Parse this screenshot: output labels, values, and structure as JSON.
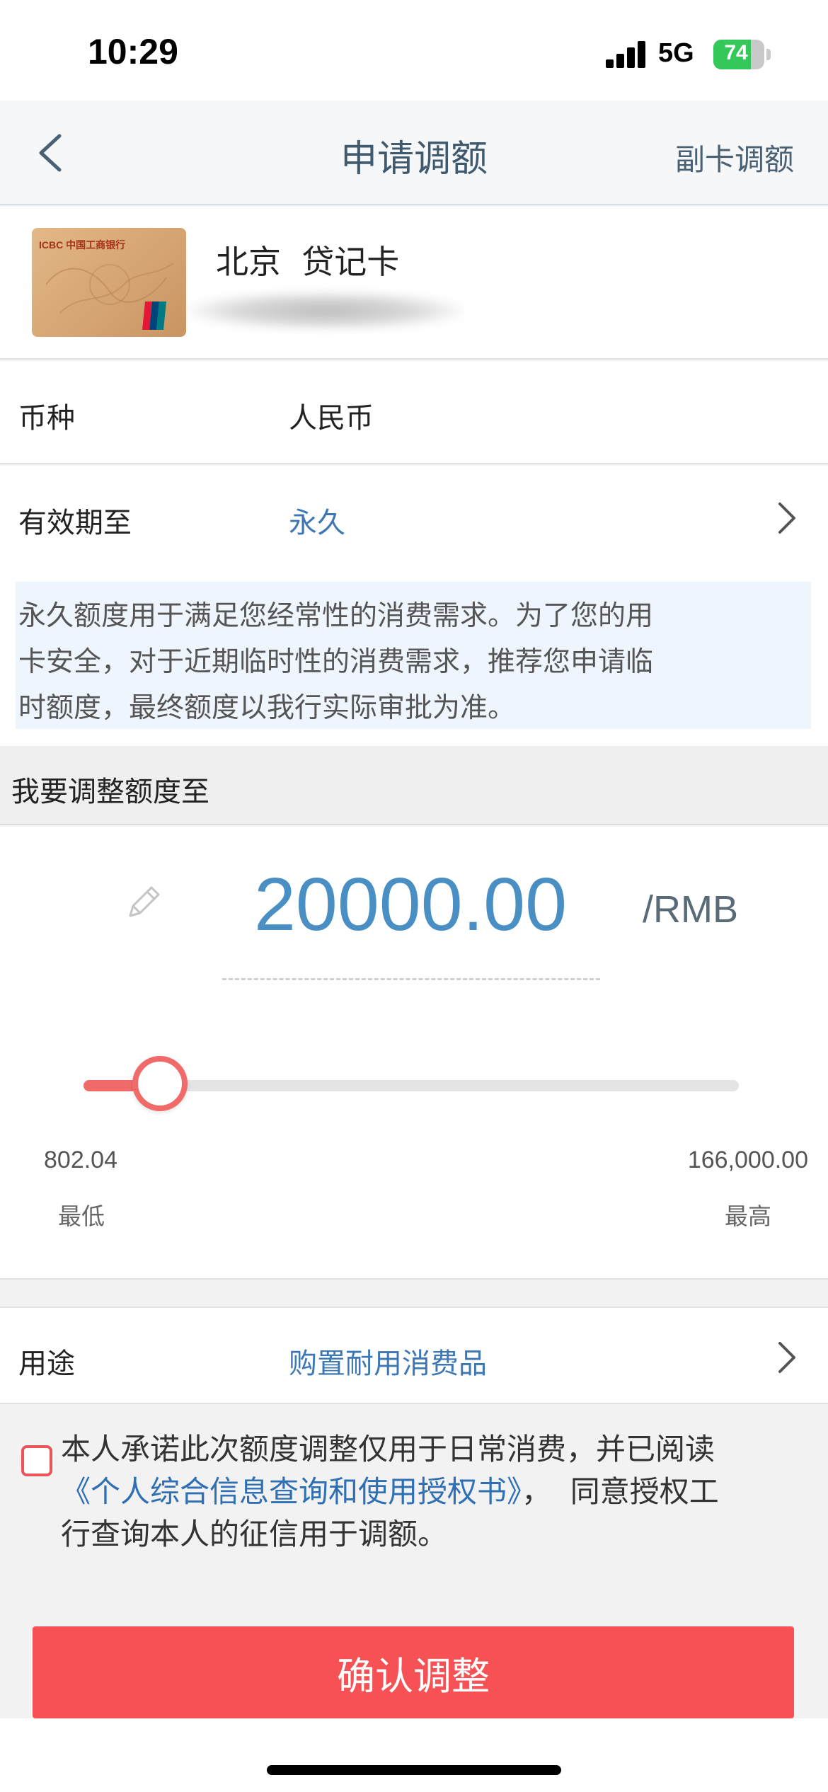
{
  "status_bar": {
    "time": "10:29",
    "network": "5G",
    "battery_percent": "74",
    "battery_level": 0.74,
    "battery_color": "#34c759"
  },
  "nav": {
    "back_icon": "chevron-left-icon",
    "title": "申请调额",
    "right_action": "副卡调额"
  },
  "card": {
    "name": "北京  贷记卡",
    "logo_text": "ICBC 中国工商银行",
    "network_icon": "unionpay-icon"
  },
  "form": {
    "currency_label": "币种",
    "currency_value": "人民币",
    "validity_label": "有效期至",
    "validity_value": "永久",
    "notice_lines": [
      "永久额度用于满足您经常性的消费需求。为了您的用",
      "卡安全，对于近期临时性的消费需求，推荐您申请临",
      "时额度，最终额度以我行实际审批为准。"
    ],
    "section_title": "我要调整额度至"
  },
  "amount": {
    "value": "20000.00",
    "unit": "/RMB",
    "edit_icon": "pencil-icon",
    "min_value": "802.04",
    "min_label": "最低",
    "max_value": "166,000.00",
    "max_label": "最高",
    "slider_min": 802.04,
    "slider_max": 166000,
    "slider_current": 20000,
    "accent_color": "#f06a6a"
  },
  "purpose": {
    "label": "用途",
    "value": "购置耐用消费品"
  },
  "agreement": {
    "line1": "本人承诺此次额度调整仅用于日常消费，并已阅读",
    "link": "《个人综合信息查询和使用授权书》",
    "line2_rest": "，  同意授权工",
    "line3": "行查询本人的征信用于调额。"
  },
  "confirm_button": {
    "label": "确认调整",
    "color": "#f65255"
  }
}
